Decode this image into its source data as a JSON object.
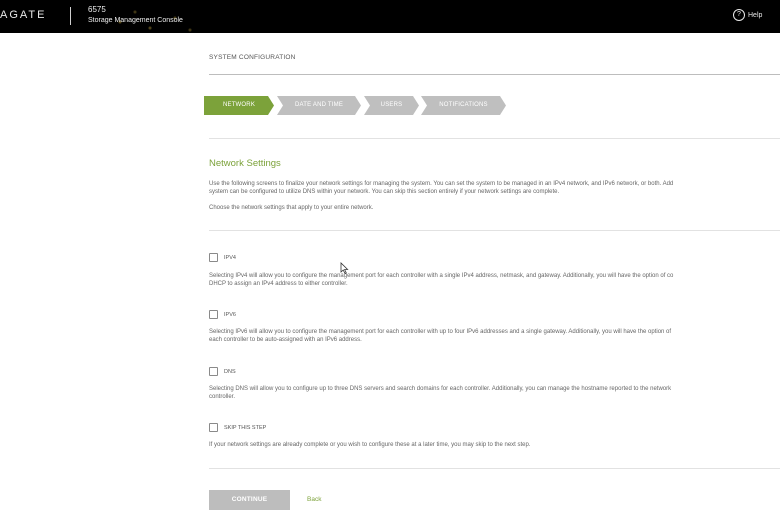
{
  "header": {
    "brand": "AGATE",
    "system_id": "6575",
    "system_name": "Storage Management Console",
    "help_icon": "?",
    "help_label": "Help"
  },
  "page": {
    "section_title": "SYSTEM CONFIGURATION"
  },
  "wizard": {
    "steps": [
      {
        "label": "NETWORK",
        "state": "active"
      },
      {
        "label": "DATE AND TIME",
        "state": "inactive"
      },
      {
        "label": "USERS",
        "state": "inactive"
      },
      {
        "label": "NOTIFICATIONS",
        "state": "inactive"
      }
    ]
  },
  "network": {
    "heading": "Network Settings",
    "intro_line1": "Use the following screens to finalize your network settings for managing the system. You can set the system to be managed in an IPv4 network, and IPv6 network, or both. Add",
    "intro_line2": "system can be configured to utilize DNS within your network. You can skip this section entirely if your network settings are complete.",
    "choose_text": "Choose the network settings that apply to your entire network.",
    "options": [
      {
        "label": "IPV4",
        "checked": false,
        "desc_line1": "Selecting IPv4 will allow you to configure the management port for each controller with a single IPv4 address, netmask, and gateway. Additionally, you will have the option of co",
        "desc_line2": "DHCP to assign an IPv4 address to either controller."
      },
      {
        "label": "IPV6",
        "checked": false,
        "desc_line1": "Selecting IPv6 will allow you to configure the management port for each controller with up to four IPv6 addresses and a single gateway. Additionally, you will have the option of",
        "desc_line2": "each controller to be auto-assigned with an IPv6 address."
      },
      {
        "label": "DNS",
        "checked": false,
        "desc_line1": "Selecting DNS will allow you to configure up to three DNS servers and search domains for each controller. Additionally, you can manage the hostname reported to the network",
        "desc_line2": "controller."
      },
      {
        "label": "SKIP THIS STEP",
        "checked": false,
        "desc_line1": "If your network settings are already complete or you wish to configure these at a later time, you may skip to the next step.",
        "desc_line2": ""
      }
    ]
  },
  "actions": {
    "continue_label": "CONTINUE",
    "back_label": "Back"
  },
  "colors": {
    "accent": "#7ca23a",
    "step_inactive": "#bfbfbf",
    "topbar": "#000000",
    "button_disabled": "#bdbdbd"
  }
}
